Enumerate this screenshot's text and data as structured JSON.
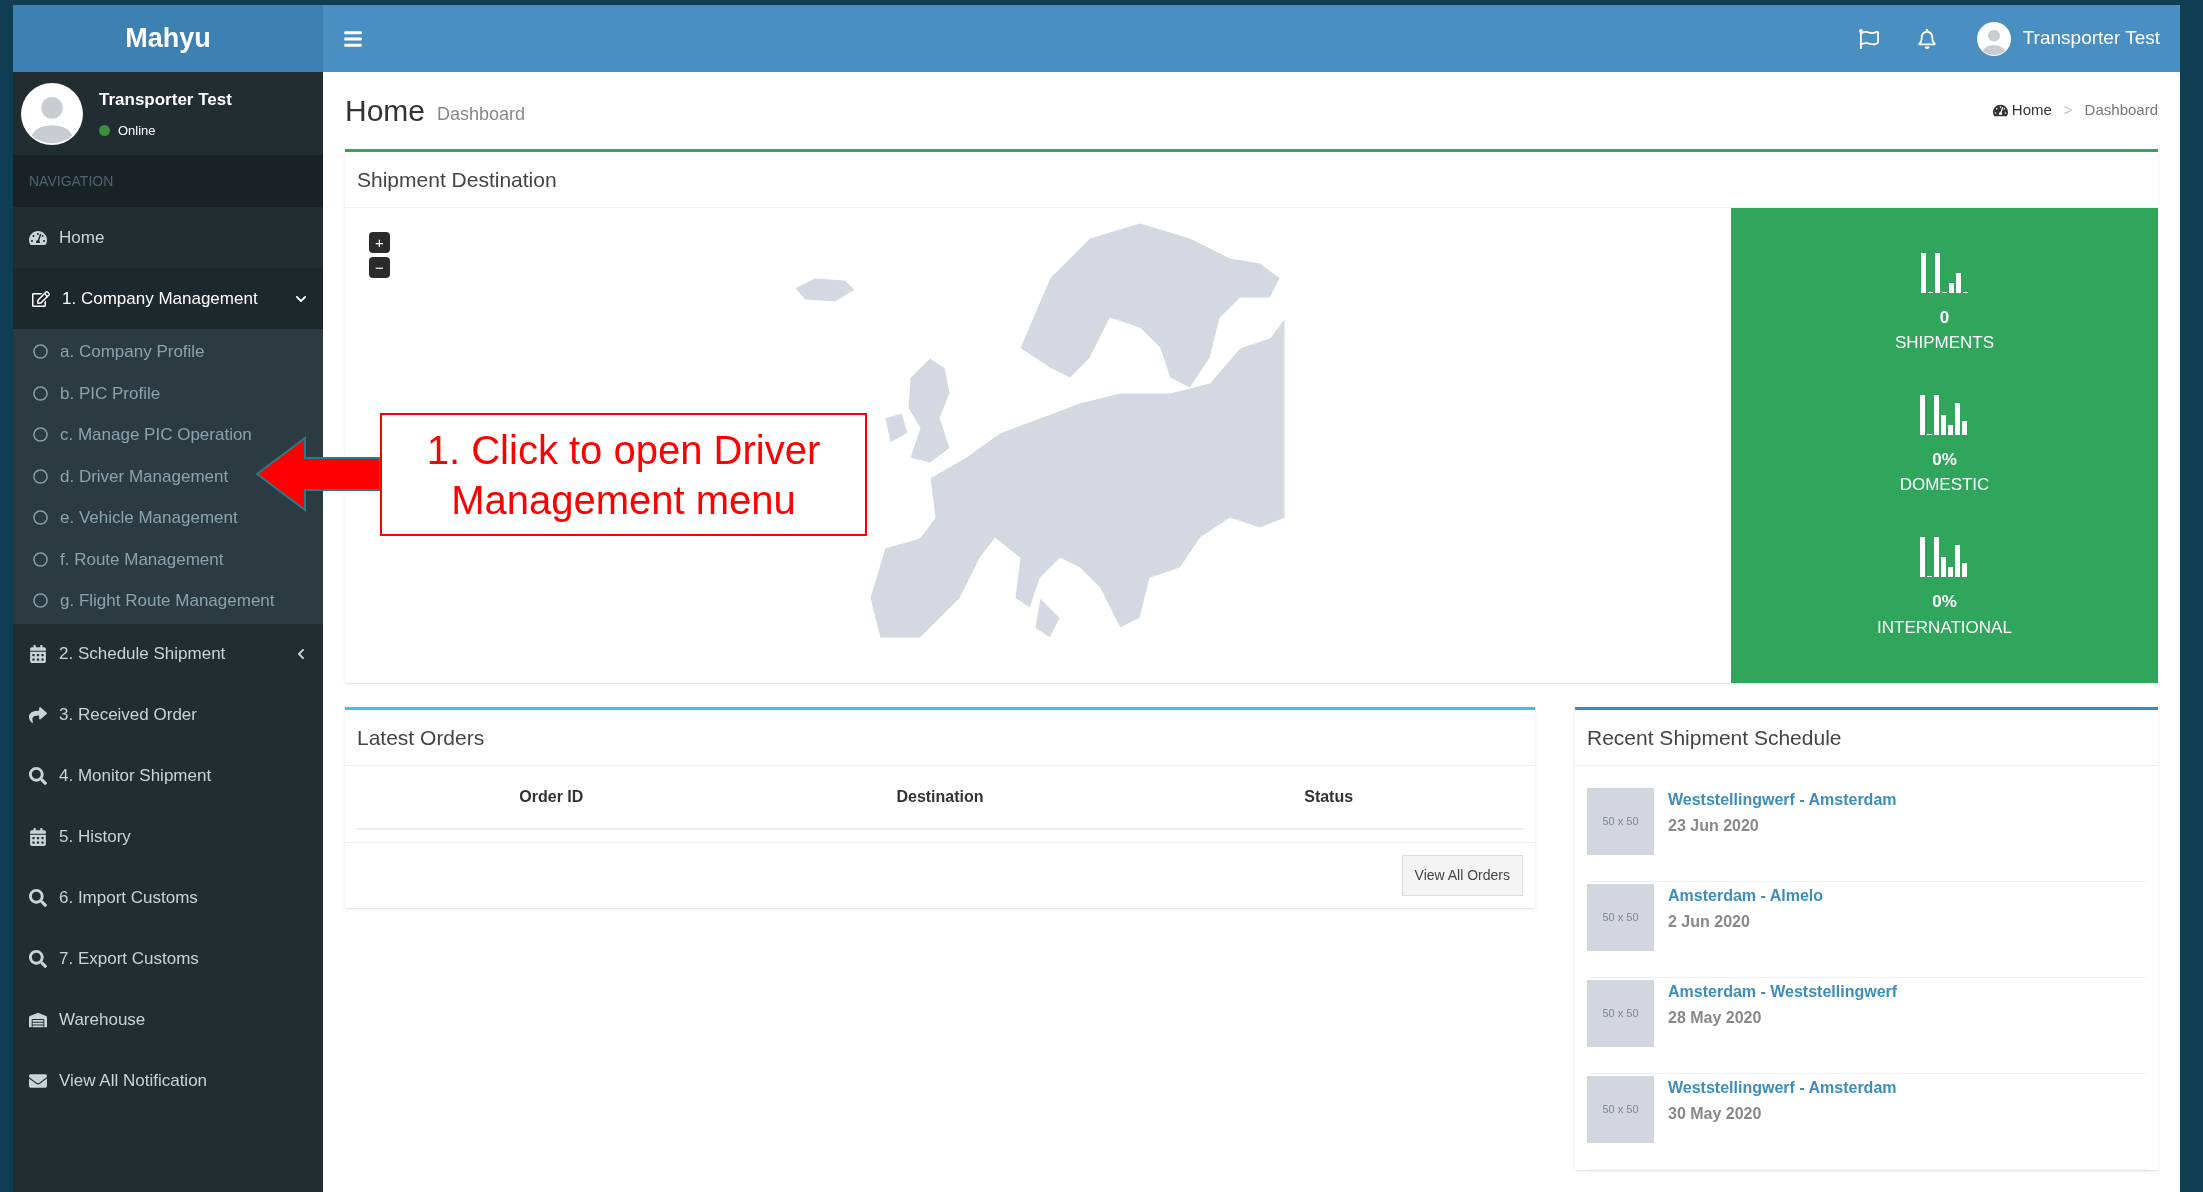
{
  "brand": "Mahyu",
  "topbar": {
    "user_name": "Transporter Test"
  },
  "user": {
    "name": "Transporter Test",
    "status": "Online"
  },
  "nav_header": "NAVIGATION",
  "sidebar": {
    "items": [
      {
        "label": "Home",
        "kind": "link",
        "selected": false
      },
      {
        "label": "1. Company Management",
        "kind": "group",
        "selected": true,
        "expanded": true,
        "children": [
          {
            "label": "a. Company Profile",
            "selected": false
          },
          {
            "label": "b. PIC Profile",
            "selected": false
          },
          {
            "label": "c. Manage PIC Operation",
            "selected": false
          },
          {
            "label": "d. Driver Management",
            "selected": false
          },
          {
            "label": "e. Vehicle Management",
            "selected": false
          },
          {
            "label": "f. Route Management",
            "selected": false
          },
          {
            "label": "g. Flight Route Management",
            "selected": false
          }
        ]
      },
      {
        "label": "2. Schedule Shipment",
        "kind": "group",
        "selected": false,
        "expanded": false
      },
      {
        "label": "3. Received Order",
        "kind": "link",
        "selected": false
      },
      {
        "label": "4. Monitor Shipment",
        "kind": "link",
        "selected": false
      },
      {
        "label": "5. History",
        "kind": "link",
        "selected": false
      },
      {
        "label": "6. Import Customs",
        "kind": "link",
        "selected": false
      },
      {
        "label": "7. Export Customs",
        "kind": "link",
        "selected": false
      },
      {
        "label": "Warehouse",
        "kind": "link",
        "selected": false
      },
      {
        "label": "View All Notification",
        "kind": "link",
        "selected": false
      }
    ]
  },
  "page": {
    "title": "Home",
    "subtitle": "Dashboard"
  },
  "breadcrumb": {
    "items": [
      "Home",
      "Dashboard"
    ],
    "separator": ">"
  },
  "map_box": {
    "title": "Shipment Destination",
    "zoom_in": "+",
    "zoom_out": "−",
    "stats": [
      {
        "value": "0",
        "label": "SHIPMENTS"
      },
      {
        "value": "0%",
        "label": "DOMESTIC"
      },
      {
        "value": "0%",
        "label": "INTERNATIONAL"
      }
    ]
  },
  "latest_orders": {
    "title": "Latest Orders",
    "columns": [
      "Order ID",
      "Destination",
      "Status"
    ],
    "button": "View All Orders"
  },
  "recent_schedule": {
    "title": "Recent Shipment Schedule",
    "items": [
      {
        "thumb": "50 x 50",
        "route": "Weststellingwerf - Amsterdam",
        "date": "23 Jun 2020"
      },
      {
        "thumb": "50 x 50",
        "route": "Amsterdam - Almelo",
        "date": "2 Jun 2020"
      },
      {
        "thumb": "50 x 50",
        "route": "Amsterdam - Weststellingwerf",
        "date": "28 May 2020"
      },
      {
        "thumb": "50 x 50",
        "route": "Weststellingwerf - Amsterdam",
        "date": "30 May 2020"
      }
    ]
  },
  "annotation": {
    "text": "1. Click to open Driver Management menu"
  }
}
